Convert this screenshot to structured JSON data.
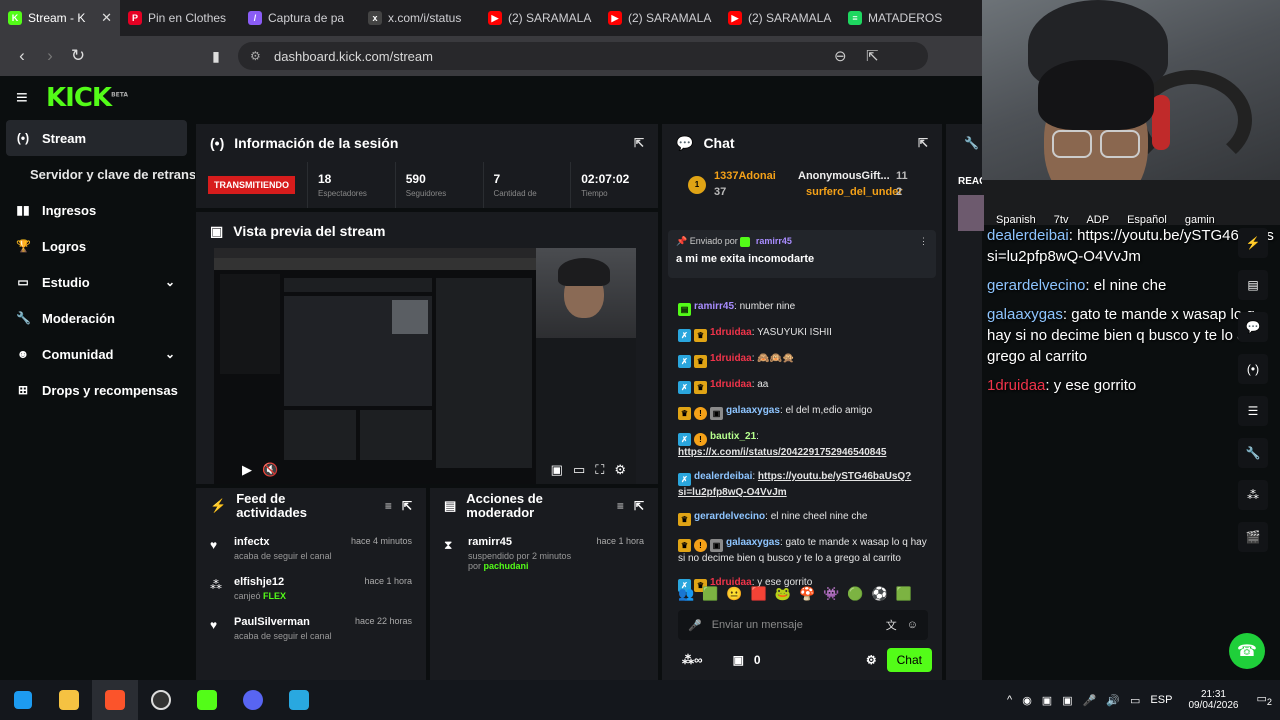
{
  "browser": {
    "tabs": [
      {
        "label": "Stream - K",
        "color": "#53fc18",
        "glyph": "K"
      },
      {
        "label": "Pin en Clothes",
        "color": "#e60023",
        "glyph": "P"
      },
      {
        "label": "Captura de pa",
        "color": "#8a5cf6",
        "glyph": "/"
      },
      {
        "label": "x.com/i/status",
        "color": "#444444",
        "glyph": "x"
      },
      {
        "label": "(2) SARAMALA",
        "color": "#ff0000",
        "glyph": "▶"
      },
      {
        "label": "(2) SARAMALA",
        "color": "#ff0000",
        "glyph": "▶"
      },
      {
        "label": "(2) SARAMALA",
        "color": "#ff0000",
        "glyph": "▶"
      },
      {
        "label": "MATADEROS",
        "color": "#1ed760",
        "glyph": "≡"
      }
    ],
    "url": "dashboard.kick.com/stream"
  },
  "app": {
    "logo": "KICK",
    "logo_sup": "BETA",
    "sidebar": [
      {
        "label": "Stream",
        "icon": "stream-icon",
        "glyph": "(•)",
        "active": true
      },
      {
        "label": "Servidor y clave de retransm",
        "sub": true
      },
      {
        "label": "Ingresos",
        "icon": "income-icon",
        "glyph": "▮▮"
      },
      {
        "label": "Logros",
        "icon": "trophy-icon",
        "glyph": "🏆"
      },
      {
        "label": "Estudio",
        "icon": "studio-icon",
        "glyph": "▭",
        "chev": true
      },
      {
        "label": "Moderación",
        "icon": "wrench-icon",
        "glyph": "🔧"
      },
      {
        "label": "Comunidad",
        "icon": "community-icon",
        "glyph": "☻",
        "chev": true
      },
      {
        "label": "Drops y recompensas",
        "icon": "drops-icon",
        "glyph": "⊞"
      }
    ],
    "session": {
      "title": "Información de la sesión",
      "live_label": "TRANSMITIENDO",
      "stats": [
        {
          "value": "18",
          "sub": "Espectadores"
        },
        {
          "value": "590",
          "sub": "Seguidores"
        },
        {
          "value": "7",
          "sub": "Cantidad de"
        },
        {
          "value": "02:07:02",
          "sub": "Tiempo"
        }
      ]
    },
    "preview": {
      "title": "Vista previa del stream"
    },
    "feed": {
      "title": "Feed de actividades",
      "items": [
        {
          "name": "infectx",
          "sub": "acaba de seguir el canal",
          "time": "hace 4 minutos",
          "icon": "heart-icon",
          "glyph": "♥"
        },
        {
          "name": "elfishje12",
          "sub": "canjeó",
          "sub_hl": "FLEX",
          "time": "hace 1 hora",
          "icon": "channel-points-icon",
          "glyph": "⁂"
        },
        {
          "name": "PaulSilverman",
          "sub": "acaba de seguir el canal",
          "time": "hace 22 horas",
          "icon": "heart-icon",
          "glyph": "♥"
        }
      ]
    },
    "modactions": {
      "title": "Acciones de moderador",
      "items": [
        {
          "name": "ramirr45",
          "sub": "suspendido por 2 minutos por",
          "sub_hl": "pachudani",
          "time": "hace 1 hora"
        }
      ]
    },
    "chat": {
      "title": "Chat",
      "top_gifters": [
        {
          "rank": "1",
          "name": "1337Adonai",
          "count": "37"
        },
        {
          "name": "AnonymousGift...",
          "count": "11"
        },
        {
          "name": "surfero_del_under",
          "count": "2"
        }
      ],
      "pinned": {
        "by_label": "Enviado por",
        "by_user": "ramirr45",
        "text": "a mi me exita incomodarte"
      },
      "messages": [
        {
          "badges": [
            "green"
          ],
          "user": "ramirr45",
          "ucls": "u-violet",
          "text": "number nine"
        },
        {
          "badges": [
            "blue",
            "gold"
          ],
          "user": "1druidaa",
          "ucls": "u-red",
          "text": "YASUYUKI ISHII"
        },
        {
          "badges": [
            "blue",
            "gold"
          ],
          "user": "1druidaa",
          "ucls": "u-red",
          "text": "🙈🙉🙊"
        },
        {
          "badges": [
            "blue",
            "gold"
          ],
          "user": "1druidaa",
          "ucls": "u-red",
          "text": "aa"
        },
        {
          "badges": [
            "gold",
            "orange",
            "grey"
          ],
          "user": "galaaxygas",
          "ucls": "u-blue",
          "text": "el del m,edio amigo"
        },
        {
          "badges": [
            "blue",
            "orange"
          ],
          "user": "bautix_21",
          "ucls": "u-green",
          "text": "",
          "link": "https://x.com/i/status/2042291752946540845"
        },
        {
          "badges": [
            "blue"
          ],
          "user": "dealerdeibai",
          "ucls": "u-blue",
          "text": "",
          "link": "https://youtu.be/ySTG46baUsQ?si=lu2pfp8wQ-O4VvJm"
        },
        {
          "badges": [
            "gold"
          ],
          "user": "gerardelvecino",
          "ucls": "u-blue",
          "text": "el nine cheel nine che"
        },
        {
          "badges": [
            "gold",
            "orange",
            "grey"
          ],
          "user": "galaaxygas",
          "ucls": "u-blue",
          "text": "gato te mande x wasap lo q hay si no decime bien q busco y te lo a grego al carrito"
        },
        {
          "badges": [
            "blue",
            "gold"
          ],
          "user": "1druidaa",
          "ucls": "u-red",
          "text": "y ese gorrito"
        }
      ],
      "input_placeholder": "Enviar un mensaje",
      "points": "0",
      "send_label": "Chat"
    },
    "right_panel_label": "REAC"
  },
  "overlay": {
    "tags": [
      "Spanish",
      "7tv",
      "ADP",
      "Español",
      "gamin"
    ],
    "lines": [
      {
        "user": "dealerdeibai",
        "ucolor": "#8ec5ff",
        "text": "https://youtu.be/ySTG46baUs si=lu2pfp8wQ-O4VvJm"
      },
      {
        "user": "gerardelvecino",
        "ucolor": "#8ec5ff",
        "text": "el nine che"
      },
      {
        "user": "galaaxygas",
        "ucolor": "#8ec5ff",
        "text": "gato te mande x wasap lo q hay si no decime bien q busco y te lo a grego al carrito"
      },
      {
        "user": "1druidaa",
        "ucolor": "#f0344a",
        "text": "y ese gorrito"
      }
    ]
  },
  "taskbar": {
    "lang": "ESP",
    "time": "21:31",
    "date": "09/04/2026",
    "notif": "2"
  },
  "colors": {
    "accent": "#53fc18",
    "live": "#d71c1c"
  }
}
